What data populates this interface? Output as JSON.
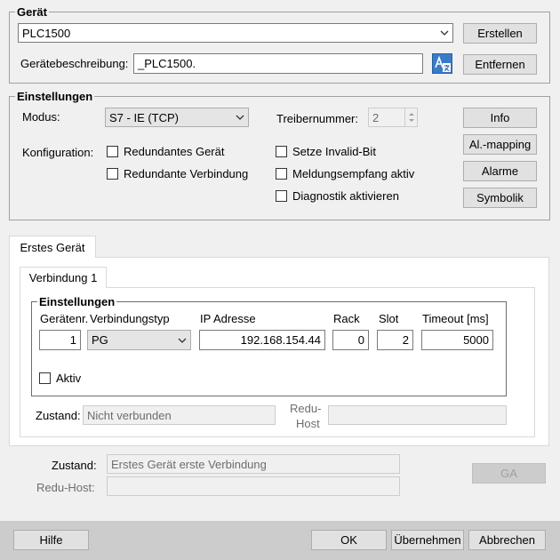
{
  "geraet": {
    "legend": "Gerät",
    "device_value": "PLC1500",
    "create_label": "Erstellen",
    "desc_label": "Gerätebeschreibung:",
    "desc_value": "_PLC1500.",
    "remove_label": "Entfernen"
  },
  "einstellungen": {
    "legend": "Einstellungen",
    "modus_label": "Modus:",
    "modus_value": "S7 - IE (TCP)",
    "treiber_label": "Treibernummer:",
    "treiber_value": "2",
    "konfig_label": "Konfiguration:",
    "checks": {
      "redundantes_geraet": "Redundantes Gerät",
      "redundante_verbindung": "Redundante Verbindung",
      "setze_invalid": "Setze Invalid-Bit",
      "meldungsempfang": "Meldungsempfang aktiv",
      "diagnostik": "Diagnostik aktivieren"
    },
    "buttons": {
      "info": "Info",
      "al_mapping": "Al.-mapping",
      "alarme": "Alarme",
      "symbolik": "Symbolik"
    }
  },
  "tabs": {
    "erstes_geraet": "Erstes Gerät",
    "verbindung_1": "Verbindung 1"
  },
  "verbindung": {
    "legend": "Einstellungen",
    "headers": {
      "geraetenr": "Gerätenr.",
      "verbindungstyp": "Verbindungstyp",
      "ip": "IP Adresse",
      "rack": "Rack",
      "slot": "Slot",
      "timeout": "Timeout [ms]"
    },
    "values": {
      "geraetenr": "1",
      "verbindungstyp": "PG",
      "ip": "192.168.154.44",
      "rack": "0",
      "slot": "2",
      "timeout": "5000"
    },
    "aktiv_label": "Aktiv",
    "zustand_label": "Zustand:",
    "zustand_value": "Nicht verbunden",
    "redu_host_label_1": "Redu-",
    "redu_host_label_2": "Host",
    "redu_host_value": ""
  },
  "status": {
    "zustand_label": "Zustand:",
    "zustand_value": "Erstes Gerät erste Verbindung",
    "redu_host_label": "Redu-Host:",
    "redu_host_value": "",
    "ga_label": "GA"
  },
  "footer": {
    "hilfe": "Hilfe",
    "ok": "OK",
    "uebernehmen": "Übernehmen",
    "abbrechen": "Abbrechen"
  }
}
